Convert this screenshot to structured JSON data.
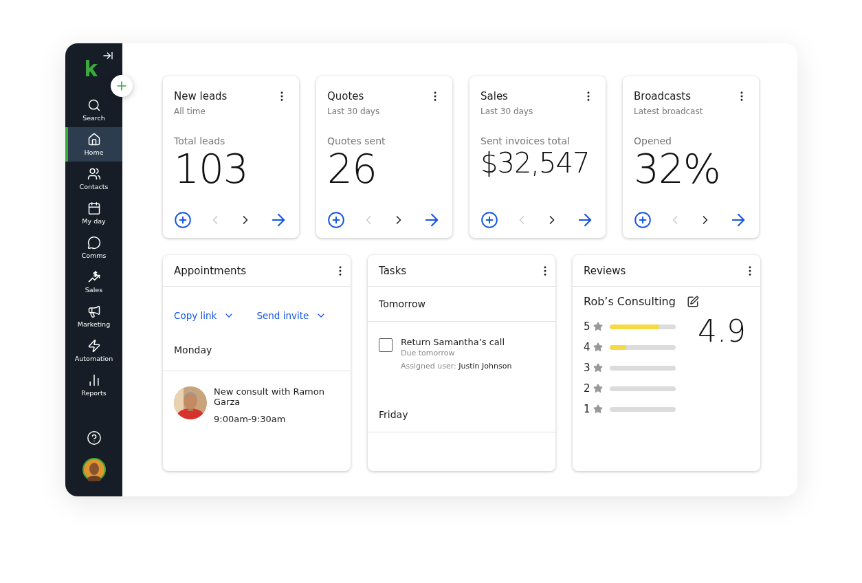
{
  "sidebar": {
    "items": [
      {
        "label": "Search",
        "selected": false
      },
      {
        "label": "Home",
        "selected": true
      },
      {
        "label": "Contacts",
        "selected": false
      },
      {
        "label": "My day",
        "selected": false
      },
      {
        "label": "Comms",
        "selected": false
      },
      {
        "label": "Sales",
        "selected": false
      },
      {
        "label": "Marketing",
        "selected": false
      },
      {
        "label": "Automation",
        "selected": false
      },
      {
        "label": "Reports",
        "selected": false
      }
    ]
  },
  "stats": [
    {
      "title": "New leads",
      "period": "All time",
      "label": "Total leads",
      "value": "103",
      "prev_disabled": true,
      "next_disabled": false
    },
    {
      "title": "Quotes",
      "period": "Last 30 days",
      "label": "Quotes sent",
      "value": "26",
      "prev_disabled": true,
      "next_disabled": false
    },
    {
      "title": "Sales",
      "period": "Last 30 days",
      "label": "Sent invoices total",
      "value": "$32,547",
      "prev_disabled": true,
      "next_disabled": false
    },
    {
      "title": "Broadcasts",
      "period": "Latest broadcast",
      "label": "Opened",
      "value": "32%",
      "prev_disabled": true,
      "next_disabled": false
    }
  ],
  "appointments": {
    "title": "Appointments",
    "actions": [
      "Copy link",
      "Send invite"
    ],
    "day": "Monday",
    "event": {
      "title": "New consult with Ramon Garza",
      "time": "9:00am-9:30am"
    }
  },
  "tasks": {
    "title": "Tasks",
    "groups": [
      {
        "day": "Tomorrow",
        "tasks": [
          {
            "title": "Return Samantha’s call",
            "due": "Due tomorrow",
            "assigned_label": "Assigned user:",
            "assignee": "Justin Johnson",
            "checked": false
          }
        ]
      },
      {
        "day": "Friday"
      }
    ]
  },
  "reviews": {
    "title": "Reviews",
    "business": "Rob’s Consulting",
    "rating": "4.9",
    "rows": [
      {
        "label": "5",
        "level": 0.75
      },
      {
        "label": "4",
        "level": 0.25
      },
      {
        "label": "3",
        "level": 0
      },
      {
        "label": "2",
        "level": 0
      },
      {
        "label": "1",
        "level": 0
      }
    ]
  }
}
